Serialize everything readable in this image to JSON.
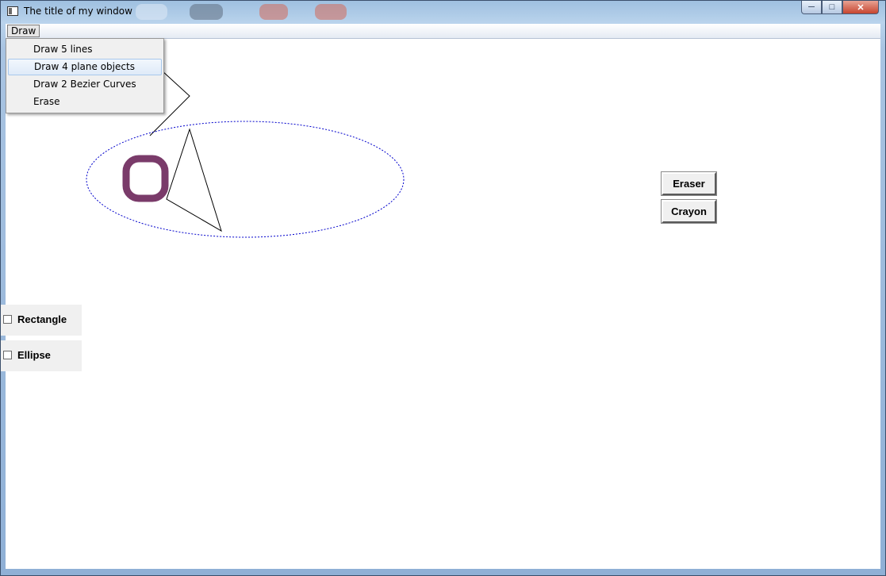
{
  "window": {
    "title": "The title of my window"
  },
  "menubar": {
    "draw": "Draw"
  },
  "draw_menu": {
    "items": [
      "Draw 5 lines",
      "Draw 4 plane objects",
      "Draw 2 Bezier Curves",
      "Erase"
    ],
    "highlighted": "Draw 4 plane objects"
  },
  "buttons": {
    "eraser": "Eraser",
    "crayon": "Crayon"
  },
  "checkboxes": {
    "rectangle": "Rectangle",
    "ellipse": "Ellipse"
  },
  "colors": {
    "ellipse_outline": "#0000cc",
    "ring_stroke": "#7a3b6a",
    "titlebar": "#b9d3ec"
  },
  "icons": [
    "window-icon",
    "minimize-icon",
    "maximize-icon",
    "close-icon"
  ]
}
